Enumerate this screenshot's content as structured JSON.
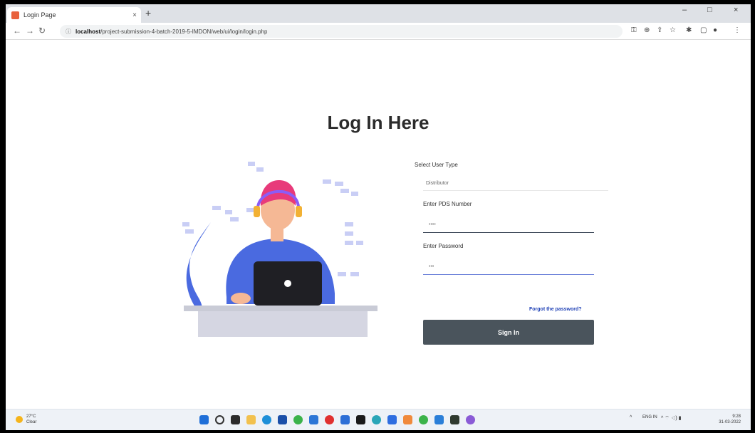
{
  "browser": {
    "tab_title": "Login Page",
    "tab_close": "×",
    "new_tab": "+",
    "url_host": "localhost",
    "url_path": "/project-submission-4-batch-2019-5-IMDON/web/ui/login/login.php",
    "win_minimize": "–",
    "win_maximize": "□",
    "win_close": "×"
  },
  "page": {
    "heading": "Log In Here",
    "form": {
      "user_type_label": "Select User Type",
      "user_type_value": "Distributor",
      "pds_label": "Enter PDS Number",
      "pds_placeholder": "••••",
      "password_label": "Enter Password",
      "password_placeholder": "•••",
      "forgot_link": "Forgot the password?",
      "signin_button": "Sign In"
    }
  },
  "taskbar": {
    "weather_temp": "27°C",
    "weather_desc": "Clear",
    "tray_lang": "ENG IN",
    "tray_icons": "^  ⌔ ◁) ▮",
    "clock_time": "9:28",
    "clock_date": "31-03-2022"
  },
  "colors": {
    "signin_bg": "#4a545c",
    "link": "#1d3fb5",
    "character_hair": "#e83a7a",
    "character_shirt": "#4a6ae0"
  }
}
